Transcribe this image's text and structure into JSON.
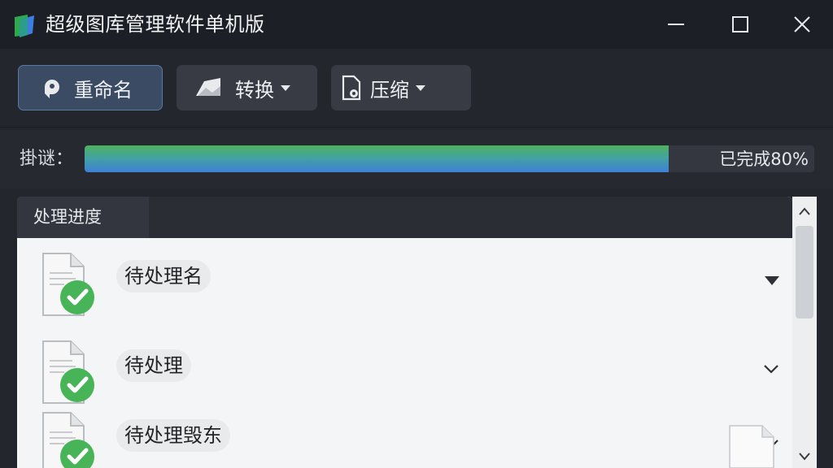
{
  "window": {
    "title": "超级图库管理软件单机版",
    "icons": {
      "app": "app-logo-icon",
      "minimize": "minimize-icon",
      "maximize": "maximize-icon",
      "close": "close-icon"
    }
  },
  "toolbar": {
    "rename": {
      "label": "重命名",
      "icon": "rename-icon"
    },
    "convert": {
      "label": "转换",
      "icon": "image-convert-icon"
    },
    "compress": {
      "label": "压缩",
      "icon": "compress-icon"
    }
  },
  "progress": {
    "label": "掛谜：",
    "value": 0.8,
    "text": "已完成80%"
  },
  "panel": {
    "tab_label": "处理进度",
    "items": [
      {
        "name": "待处理名",
        "status": "done",
        "icon": "file-check-icon",
        "expander": "triangle-down-icon"
      },
      {
        "name": "待处理",
        "status": "done",
        "icon": "file-check-icon",
        "expander": "chevron-down-icon"
      },
      {
        "name": "待处理毁东",
        "status": "done",
        "icon": "file-check-icon",
        "expander": "chevron-down-icon"
      }
    ]
  },
  "colors": {
    "titlebar": "#1c1f25",
    "background": "#23262d",
    "button": "#383b43",
    "button_active": "#3b4b63",
    "progress_green": "#4fb25e",
    "progress_blue": "#3f7fd8",
    "check_green": "#46b457",
    "panel_bg": "#f4f5f6"
  }
}
